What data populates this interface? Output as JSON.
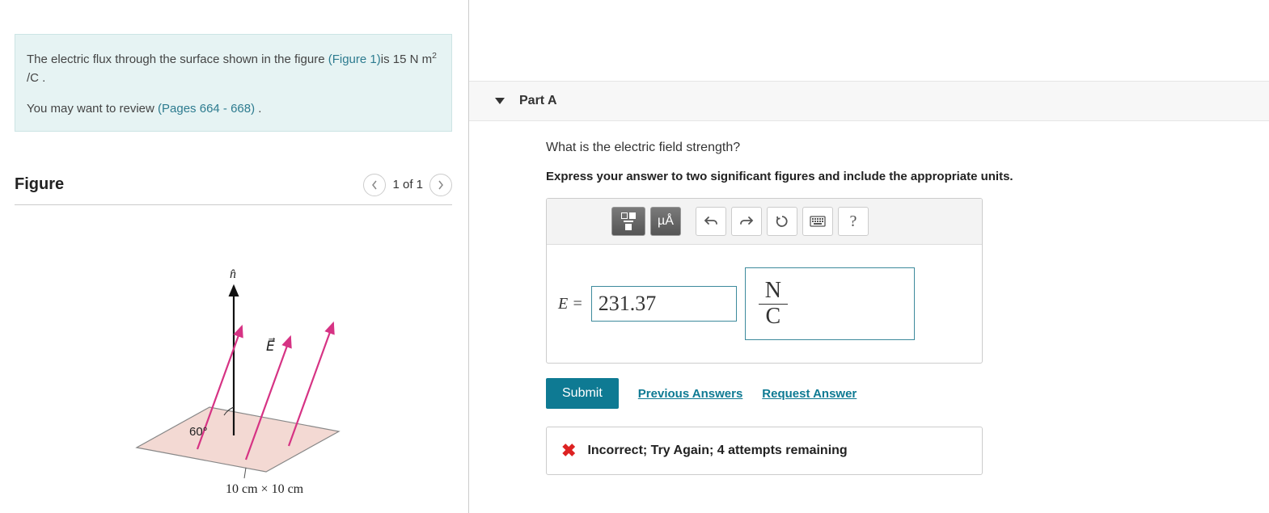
{
  "prompt": {
    "line1_pre": "The electric flux through the surface shown in the figure ",
    "figure_link": "(Figure 1)",
    "line1_post": "is 15 N m",
    "line1_sup": "2",
    "line1_tail": " /C .",
    "line2_pre": "You may want to review ",
    "pages_link": "(Pages 664 - 668)",
    "line2_tail": " ."
  },
  "figure": {
    "heading": "Figure",
    "pager": "1 of 1",
    "angle_label": "60°",
    "dim_label": "10 cm × 10 cm",
    "n_label": "n̂",
    "e_label": "E⃗"
  },
  "part": {
    "title": "Part A",
    "question": "What is the electric field strength?",
    "instruction": "Express your answer to two significant figures and include the appropriate units."
  },
  "toolbar": {
    "units_label": "µÅ",
    "help_label": "?"
  },
  "answer": {
    "var_label": "E = ",
    "value": "231.37",
    "unit_num": "N",
    "unit_den": "C"
  },
  "actions": {
    "submit": "Submit",
    "previous": "Previous Answers",
    "request": "Request Answer"
  },
  "feedback": {
    "text": "Incorrect; Try Again; 4 attempts remaining"
  }
}
